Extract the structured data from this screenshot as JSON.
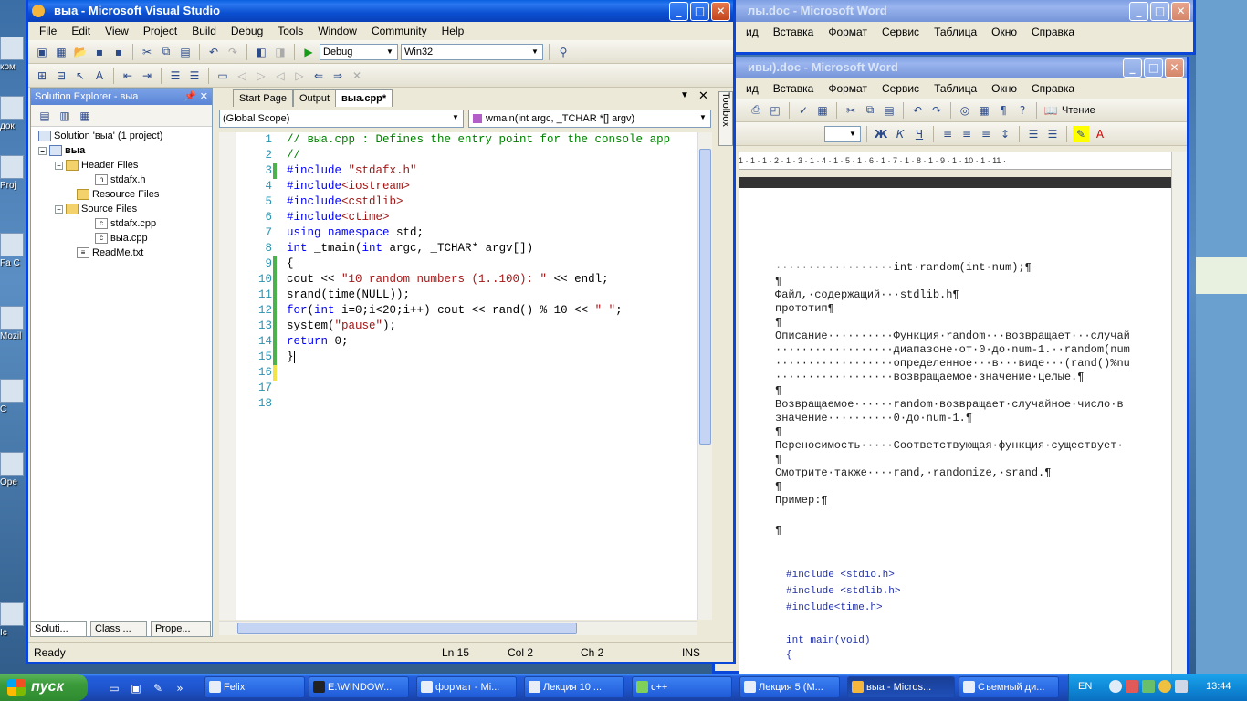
{
  "desktop": {
    "icons": [
      "ком",
      "док",
      "Proj",
      "Fa C",
      "Mozil",
      "С",
      "Ope",
      "Ic"
    ]
  },
  "word_back": {
    "title": "лы.doc - Microsoft Word",
    "menu": [
      "ид",
      "Вставка",
      "Формат",
      "Сервис",
      "Таблица",
      "Окно",
      "Справка"
    ]
  },
  "word_front": {
    "title": "ивы).doc - Microsoft Word",
    "menu": [
      "ид",
      "Вставка",
      "Формат",
      "Сервис",
      "Таблица",
      "Окно",
      "Справка"
    ],
    "read_button": "Чтение",
    "ruler": "1 · 1 · 1 · 2 · 1 · 3 · 1 · 4 · 1 · 5 · 1 · 6 · 1 · 7 · 1 · 8 · 1 · 9 · 1 · 10 · 1 · 11 ·",
    "doc_lines": [
      "··················int·random(int·num);¶",
      "¶",
      "Файл,·содержащий···stdlib.h¶",
      "прототип¶",
      "¶",
      "Описание··········Функция·random···возвращает···случай",
      "··················диапазоне·от·0·до·num-1.··random(num",
      "··················определенное···в···виде···(rand()%nu",
      "··················возвращаемое·значение·целые.¶",
      "¶",
      "Возвращаемое······random·возвращает·случайное·число·в",
      "значение··········0·до·num-1.¶",
      "¶",
      "Переносимость·····Соответствующая·функция·существует·",
      "¶",
      "Смотрите·также····rand,·randomize,·srand.¶",
      "¶",
      "Пример:¶",
      "",
      "¶"
    ],
    "code_lines": [
      "#include <stdio.h>",
      "#include <stdlib.h>",
      "#include<time.h>",
      "",
      "int main(void)",
      "{"
    ]
  },
  "vs": {
    "title": "выа - Microsoft Visual Studio",
    "menu": [
      "File",
      "Edit",
      "View",
      "Project",
      "Build",
      "Debug",
      "Tools",
      "Window",
      "Community",
      "Help"
    ],
    "config": "Debug",
    "platform": "Win32",
    "solution_explorer": {
      "title": "Solution Explorer - выа",
      "items": [
        "Solution 'выа' (1 project)",
        "выа",
        "Header Files",
        "stdafx.h",
        "Resource Files",
        "Source Files",
        "stdafx.cpp",
        "выа.cpp",
        "ReadMe.txt"
      ]
    },
    "bottom_tabs": [
      "Soluti...",
      "Class ...",
      "Prope..."
    ],
    "doc_tabs": [
      "Start Page",
      "Output",
      "выа.cpp*"
    ],
    "scope": "(Global Scope)",
    "function": "wmain(int argc, _TCHAR *[] argv)",
    "toolbox": "Toolbox",
    "line_numbers": [
      "1",
      "2",
      "3",
      "4",
      "5",
      "6",
      "7",
      "8",
      "9",
      "10",
      "11",
      "12",
      "13",
      "14",
      "15",
      "16",
      "17",
      "18"
    ],
    "status": {
      "ready": "Ready",
      "ln": "Ln 15",
      "col": "Col 2",
      "ch": "Ch 2",
      "ins": "INS"
    }
  },
  "taskbar": {
    "start": "пуск",
    "tasks": [
      "Felix",
      "E:\\WINDOW...",
      "формат - Mi...",
      "Лекция 10 ...",
      "c++",
      "Лекция 5 (М...",
      "выа - Micros...",
      "Съемный ди..."
    ],
    "lang": "EN",
    "clock": "13:44"
  }
}
